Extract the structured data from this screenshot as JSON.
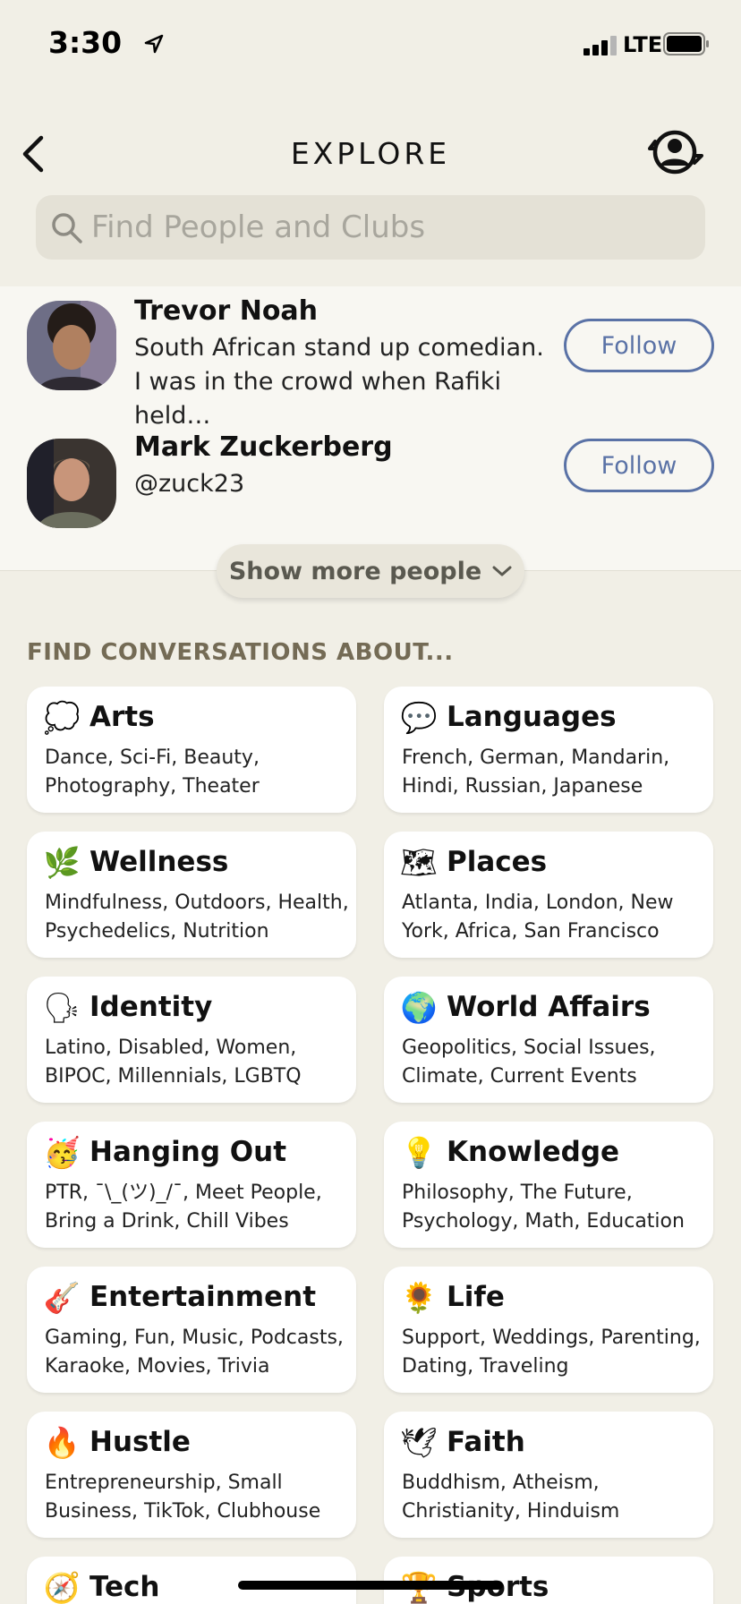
{
  "status_bar": {
    "time": "3:30",
    "network": "LTE"
  },
  "nav": {
    "title": "EXPLORE"
  },
  "search": {
    "placeholder": "Find People and Clubs"
  },
  "people": [
    {
      "name": "Trevor Noah",
      "subtitle": "South African stand up comedian. I was in the crowd when Rafiki held…",
      "follow_label": "Follow"
    },
    {
      "name": "Mark Zuckerberg",
      "subtitle": "@zuck23",
      "follow_label": "Follow"
    }
  ],
  "show_more": {
    "label": "Show more people"
  },
  "section": {
    "title": "FIND CONVERSATIONS ABOUT..."
  },
  "topics": [
    {
      "emoji": "💭",
      "title": "Arts",
      "desc": "Dance, Sci-Fi, Beauty, Photography, Theater"
    },
    {
      "emoji": "💬",
      "title": "Languages",
      "desc": "French, German, Mandarin, Hindi, Russian, Japanese"
    },
    {
      "emoji": "🌿",
      "title": "Wellness",
      "desc": "Mindfulness, Outdoors, Health, Psychedelics, Nutrition"
    },
    {
      "emoji": "🗺",
      "title": "Places",
      "desc": "Atlanta, India, London, New York, Africa, San Francisco"
    },
    {
      "emoji": "🗣",
      "title": "Identity",
      "desc": "Latino, Disabled, Women, BIPOC, Millennials, LGBTQ"
    },
    {
      "emoji": "🌍",
      "title": "World Affairs",
      "desc": "Geopolitics, Social Issues, Climate, Current Events"
    },
    {
      "emoji": "🥳",
      "title": "Hanging Out",
      "desc": "PTR, ¯\\_(ツ)_/¯, Meet People, Bring a Drink, Chill Vibes"
    },
    {
      "emoji": "💡",
      "title": "Knowledge",
      "desc": "Philosophy, The Future, Psychology, Math, Education"
    },
    {
      "emoji": "🎸",
      "title": "Entertainment",
      "desc": "Gaming, Fun, Music, Podcasts, Karaoke, Movies, Trivia"
    },
    {
      "emoji": "🌻",
      "title": "Life",
      "desc": "Support, Weddings, Parenting, Dating, Traveling"
    },
    {
      "emoji": "🔥",
      "title": "Hustle",
      "desc": "Entrepreneurship, Small Business, TikTok, Clubhouse"
    },
    {
      "emoji": "🕊",
      "title": "Faith",
      "desc": "Buddhism, Atheism, Christianity, Hinduism"
    },
    {
      "emoji": "🧭",
      "title": "Tech",
      "desc": ""
    },
    {
      "emoji": "🏆",
      "title": "Sports",
      "desc": ""
    }
  ],
  "colors": {
    "background": "#f1efe6",
    "accent": "#5a72a6",
    "section_title": "#746b55"
  }
}
